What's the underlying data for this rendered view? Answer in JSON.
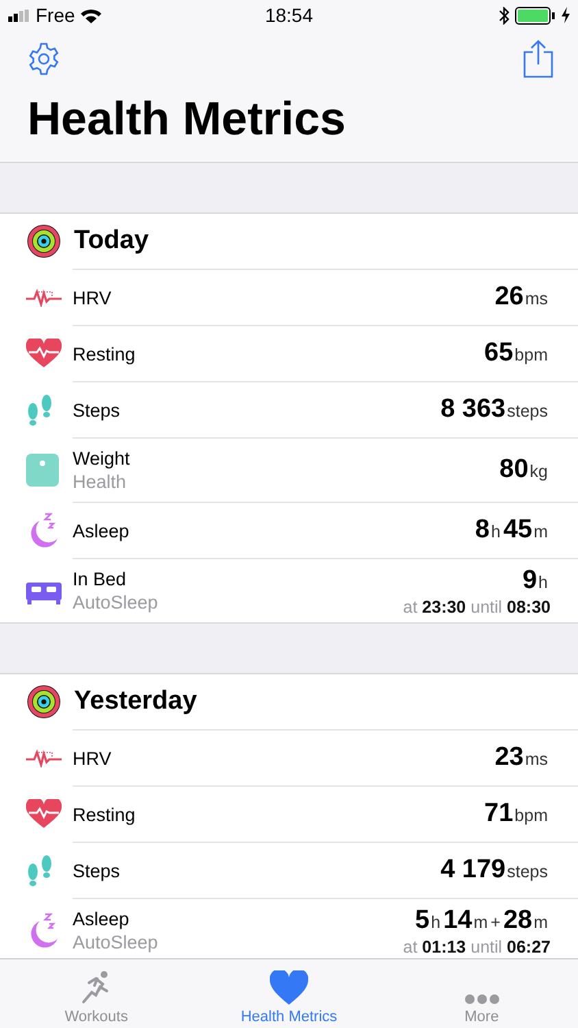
{
  "status_bar": {
    "carrier": "Free",
    "time": "18:54"
  },
  "title": "Health Metrics",
  "sections": [
    {
      "title": "Today",
      "rows": [
        {
          "kind": "hrv",
          "label": "HRV",
          "value": [
            {
              "kind": "num",
              "text": "26"
            },
            {
              "kind": "unit",
              "text": "ms"
            }
          ]
        },
        {
          "kind": "resting",
          "label": "Resting",
          "value": [
            {
              "kind": "num",
              "text": "65"
            },
            {
              "kind": "unit",
              "text": "bpm"
            }
          ]
        },
        {
          "kind": "steps",
          "label": "Steps",
          "value": [
            {
              "kind": "num",
              "text": "8 363"
            },
            {
              "kind": "unit",
              "text": "steps"
            }
          ]
        },
        {
          "kind": "weight",
          "label": "Weight",
          "source": "Health",
          "value": [
            {
              "kind": "num",
              "text": "80"
            },
            {
              "kind": "unit",
              "text": "kg"
            }
          ]
        },
        {
          "kind": "asleep",
          "label": "Asleep",
          "value": [
            {
              "kind": "num",
              "text": "8"
            },
            {
              "kind": "unit",
              "text": "h"
            },
            {
              "kind": "num",
              "text": "45"
            },
            {
              "kind": "unit",
              "text": "m"
            }
          ]
        },
        {
          "kind": "bed",
          "label": "In Bed",
          "source": "AutoSleep",
          "value": [
            {
              "kind": "num",
              "text": "9"
            },
            {
              "kind": "unit",
              "text": "h"
            }
          ],
          "detail": [
            {
              "kind": "word",
              "text": "at"
            },
            {
              "kind": "time",
              "text": "23:30"
            },
            {
              "kind": "word",
              "text": "until"
            },
            {
              "kind": "time",
              "text": "08:30"
            }
          ]
        }
      ]
    },
    {
      "title": "Yesterday",
      "rows": [
        {
          "kind": "hrv",
          "label": "HRV",
          "value": [
            {
              "kind": "num",
              "text": "23"
            },
            {
              "kind": "unit",
              "text": "ms"
            }
          ]
        },
        {
          "kind": "resting",
          "label": "Resting",
          "value": [
            {
              "kind": "num",
              "text": "71"
            },
            {
              "kind": "unit",
              "text": "bpm"
            }
          ]
        },
        {
          "kind": "steps",
          "label": "Steps",
          "value": [
            {
              "kind": "num",
              "text": "4 179"
            },
            {
              "kind": "unit",
              "text": "steps"
            }
          ]
        },
        {
          "kind": "asleep",
          "label": "Asleep",
          "source": "AutoSleep",
          "value": [
            {
              "kind": "num",
              "text": "5"
            },
            {
              "kind": "unit",
              "text": "h"
            },
            {
              "kind": "num",
              "text": "14"
            },
            {
              "kind": "unit",
              "text": "m"
            },
            {
              "kind": "unit",
              "text": "+"
            },
            {
              "kind": "num",
              "text": "28"
            },
            {
              "kind": "unit",
              "text": "m"
            }
          ],
          "detail": [
            {
              "kind": "word",
              "text": "at"
            },
            {
              "kind": "time",
              "text": "01:13"
            },
            {
              "kind": "word",
              "text": "until"
            },
            {
              "kind": "time",
              "text": "06:27"
            }
          ]
        }
      ]
    }
  ],
  "tabs": [
    {
      "kind": "workouts",
      "label": "Workouts",
      "selected": false
    },
    {
      "kind": "health",
      "label": "Health Metrics",
      "selected": true
    },
    {
      "kind": "more",
      "label": "More",
      "selected": false
    }
  ]
}
